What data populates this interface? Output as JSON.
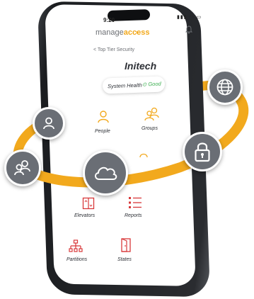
{
  "status": {
    "time": "9:20",
    "icons": "▮▮▮ ◠ ▭"
  },
  "app": {
    "brand_left": "manage",
    "brand_right": "access"
  },
  "nav": {
    "back_label": "< Top Tier Security"
  },
  "site": {
    "title": "Initech"
  },
  "health": {
    "label": "System Health",
    "status": "Good",
    "status_color": "#3cae50"
  },
  "tiles": [
    {
      "label": "People",
      "icon": "person-icon"
    },
    {
      "label": "Groups",
      "icon": "group-icon"
    },
    {
      "label": "Elevators",
      "icon": "elevator-icon"
    },
    {
      "label": "Reports",
      "icon": "reports-icon"
    },
    {
      "label": "Partitions",
      "icon": "partitions-icon"
    },
    {
      "label": "States",
      "icon": "door-icon"
    }
  ],
  "colors": {
    "accent": "#f2a91d",
    "node": "#6a6e75",
    "tile_red": "#d8383a"
  },
  "orbit_nodes": [
    "person-icon",
    "group-icon",
    "cloud-icon",
    "lock-icon",
    "globe-icon"
  ]
}
